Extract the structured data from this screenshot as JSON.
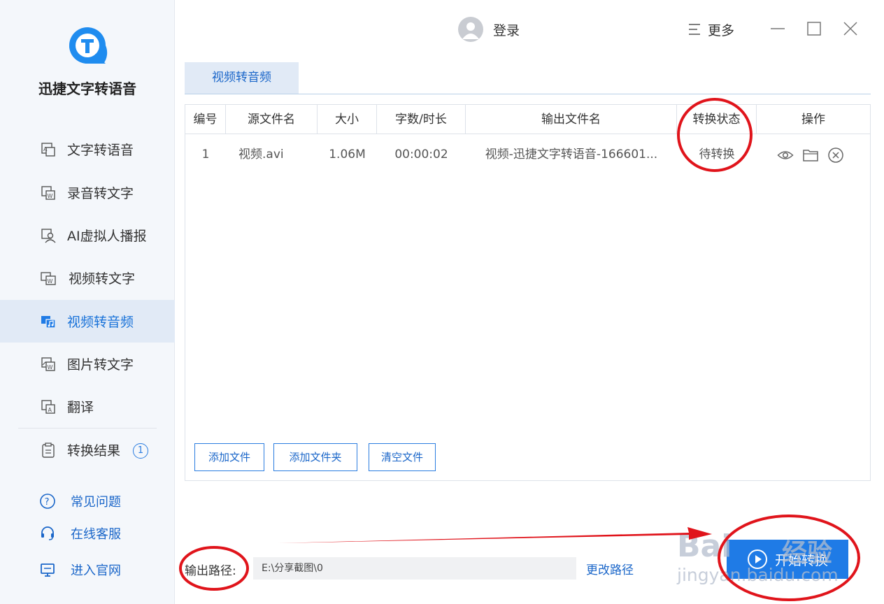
{
  "app": {
    "name": "迅捷文字转语音"
  },
  "sidebar": {
    "items": [
      {
        "label": "文字转语音"
      },
      {
        "label": "录音转文字"
      },
      {
        "label": "AI虚拟人播报"
      },
      {
        "label": "视频转文字"
      },
      {
        "label": "视频转音频"
      },
      {
        "label": "图片转文字"
      },
      {
        "label": "翻译"
      },
      {
        "label": "转换结果",
        "badge": "1"
      }
    ],
    "active": "视频转音频",
    "help": [
      {
        "label": "常见问题"
      },
      {
        "label": "在线客服"
      },
      {
        "label": "进入官网"
      }
    ]
  },
  "header": {
    "login_label": "登录",
    "more_label": "更多"
  },
  "tab": {
    "label": "视频转音频"
  },
  "table": {
    "columns": [
      "编号",
      "源文件名",
      "大小",
      "字数/时长",
      "输出文件名",
      "转换状态",
      "操作"
    ],
    "rows": [
      {
        "index": "1",
        "source": "视频.avi",
        "size": "1.06M",
        "duration": "00:00:02",
        "output": "视频-迅捷文字转语音-166601...",
        "status": "待转换"
      }
    ]
  },
  "buttons": {
    "add_file": "添加文件",
    "add_folder": "添加文件夹",
    "clear_files": "清空文件"
  },
  "output": {
    "label": "输出路径:",
    "path": "E:\\分享截图\\0",
    "change_label": "更改路径"
  },
  "start_label": "开始转换",
  "watermark": {
    "brand": "Bai",
    "brand2": "经验",
    "url": "jingyan.baidu.com"
  },
  "colors": {
    "accent": "#1f7be6",
    "active_bg": "#e1eaf6",
    "annotation": "#e0141b"
  }
}
